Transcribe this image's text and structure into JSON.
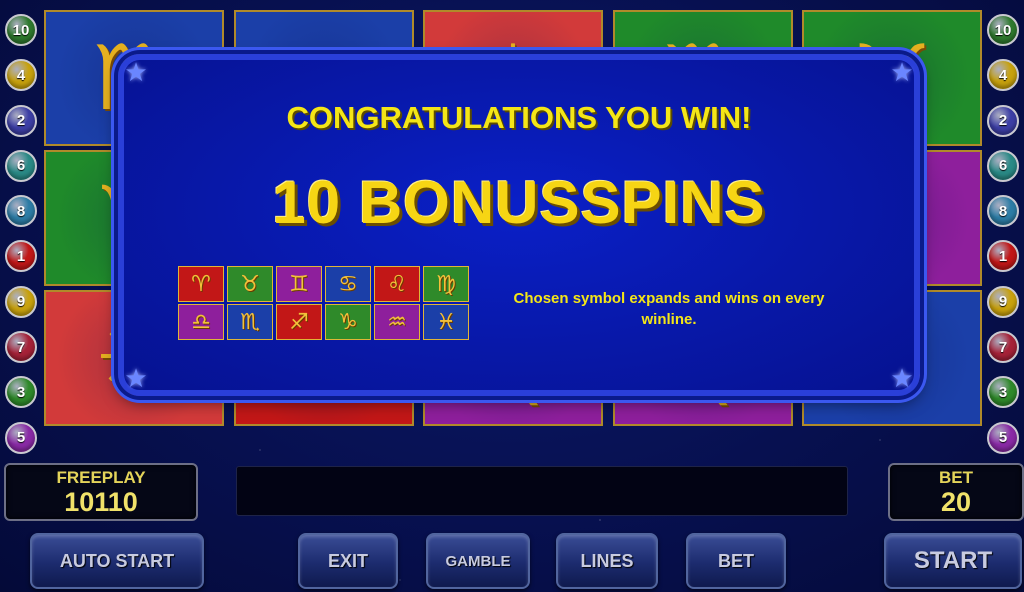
{
  "line_numbers": {
    "left": [
      {
        "n": "10",
        "color": "#2f7a2e"
      },
      {
        "n": "4",
        "color": "#c8a20e"
      },
      {
        "n": "2",
        "color": "#3d3fa6"
      },
      {
        "n": "6",
        "color": "#2a8a86"
      },
      {
        "n": "8",
        "color": "#2d7da6"
      },
      {
        "n": "1",
        "color": "#c21717"
      },
      {
        "n": "9",
        "color": "#c9a20e"
      },
      {
        "n": "7",
        "color": "#a62238"
      },
      {
        "n": "3",
        "color": "#2f8a2a"
      },
      {
        "n": "5",
        "color": "#8a2aa6"
      }
    ],
    "right": [
      {
        "n": "10",
        "color": "#2f7a2e"
      },
      {
        "n": "4",
        "color": "#c8a20e"
      },
      {
        "n": "2",
        "color": "#3d3fa6"
      },
      {
        "n": "6",
        "color": "#2a8a86"
      },
      {
        "n": "8",
        "color": "#2d7da6"
      },
      {
        "n": "1",
        "color": "#c21717"
      },
      {
        "n": "9",
        "color": "#c9a20e"
      },
      {
        "n": "7",
        "color": "#a62238"
      },
      {
        "n": "3",
        "color": "#2f8a2a"
      },
      {
        "n": "5",
        "color": "#8a2aa6"
      }
    ]
  },
  "reels": [
    {
      "col": 0,
      "row": 0,
      "symbol": "scorpio-icon",
      "glyph": "♏",
      "bg": "#1b3fa8"
    },
    {
      "col": 0,
      "row": 1,
      "symbol": "capricorn-icon",
      "glyph": "♑",
      "bg": "#1f8a2a"
    },
    {
      "col": 0,
      "row": 2,
      "symbol": "sun-icon",
      "glyph": "☀",
      "bg": "#d23a3a"
    },
    {
      "col": 1,
      "row": 0,
      "symbol": "shell-icon",
      "glyph": "♋",
      "bg": "#1b3fa8"
    },
    {
      "col": 1,
      "row": 2,
      "symbol": "centaur-icon",
      "glyph": "♐",
      "bg": "#c21717"
    },
    {
      "col": 2,
      "row": 0,
      "symbol": "sun-icon",
      "glyph": "☀",
      "bg": "#d23a3a"
    },
    {
      "col": 2,
      "row": 2,
      "symbol": "virgo-icon",
      "glyph": "♍",
      "bg": "#8e1f9c"
    },
    {
      "col": 3,
      "row": 0,
      "symbol": "virgo-icon",
      "glyph": "♍",
      "bg": "#1f8a2a"
    },
    {
      "col": 3,
      "row": 2,
      "symbol": "virgo-icon",
      "glyph": "♍",
      "bg": "#8e1f9c"
    },
    {
      "col": 4,
      "row": 0,
      "symbol": "taurus-icon",
      "glyph": "♉",
      "bg": "#1f8a2a"
    },
    {
      "col": 4,
      "row": 1,
      "symbol": "sagittarius-icon",
      "glyph": "♐",
      "bg": "#8e1f9c"
    },
    {
      "col": 4,
      "row": 2,
      "symbol": "cancer-icon",
      "glyph": "♋",
      "bg": "#1b3fa8"
    }
  ],
  "popup": {
    "congrats": "CONGRATULATIONS YOU WIN!",
    "bonus": "10 BONUSSPINS",
    "description": "Chosen symbol expands and wins on every winline.",
    "symbols": [
      {
        "name": "aries-icon",
        "glyph": "♈",
        "bg": "#c21717"
      },
      {
        "name": "taurus-icon",
        "glyph": "♉",
        "bg": "#2f8a2a"
      },
      {
        "name": "gemini-icon",
        "glyph": "♊",
        "bg": "#8e1f9c"
      },
      {
        "name": "cancer-icon",
        "glyph": "♋",
        "bg": "#1b3fa8"
      },
      {
        "name": "leo-icon",
        "glyph": "♌",
        "bg": "#c21717"
      },
      {
        "name": "virgo-icon",
        "glyph": "♍",
        "bg": "#2f8a2a"
      },
      {
        "name": "libra-icon",
        "glyph": "♎",
        "bg": "#8e1f9c"
      },
      {
        "name": "scorpio-icon",
        "glyph": "♏",
        "bg": "#1b3fa8"
      },
      {
        "name": "sagittarius-icon",
        "glyph": "♐",
        "bg": "#c21717"
      },
      {
        "name": "capricorn-icon",
        "glyph": "♑",
        "bg": "#2f8a2a"
      },
      {
        "name": "aquarius-icon",
        "glyph": "♒",
        "bg": "#8e1f9c"
      },
      {
        "name": "pisces-icon",
        "glyph": "♓",
        "bg": "#1b3fa8"
      }
    ]
  },
  "freeplay": {
    "label": "FREEPLAY",
    "value": "10110"
  },
  "bet_display": {
    "label": "BET",
    "value": "20"
  },
  "buttons": {
    "auto_start": "AUTO START",
    "exit": "EXIT",
    "gamble": "GAMBLE",
    "lines": "LINES",
    "bet": "BET",
    "start": "START"
  }
}
